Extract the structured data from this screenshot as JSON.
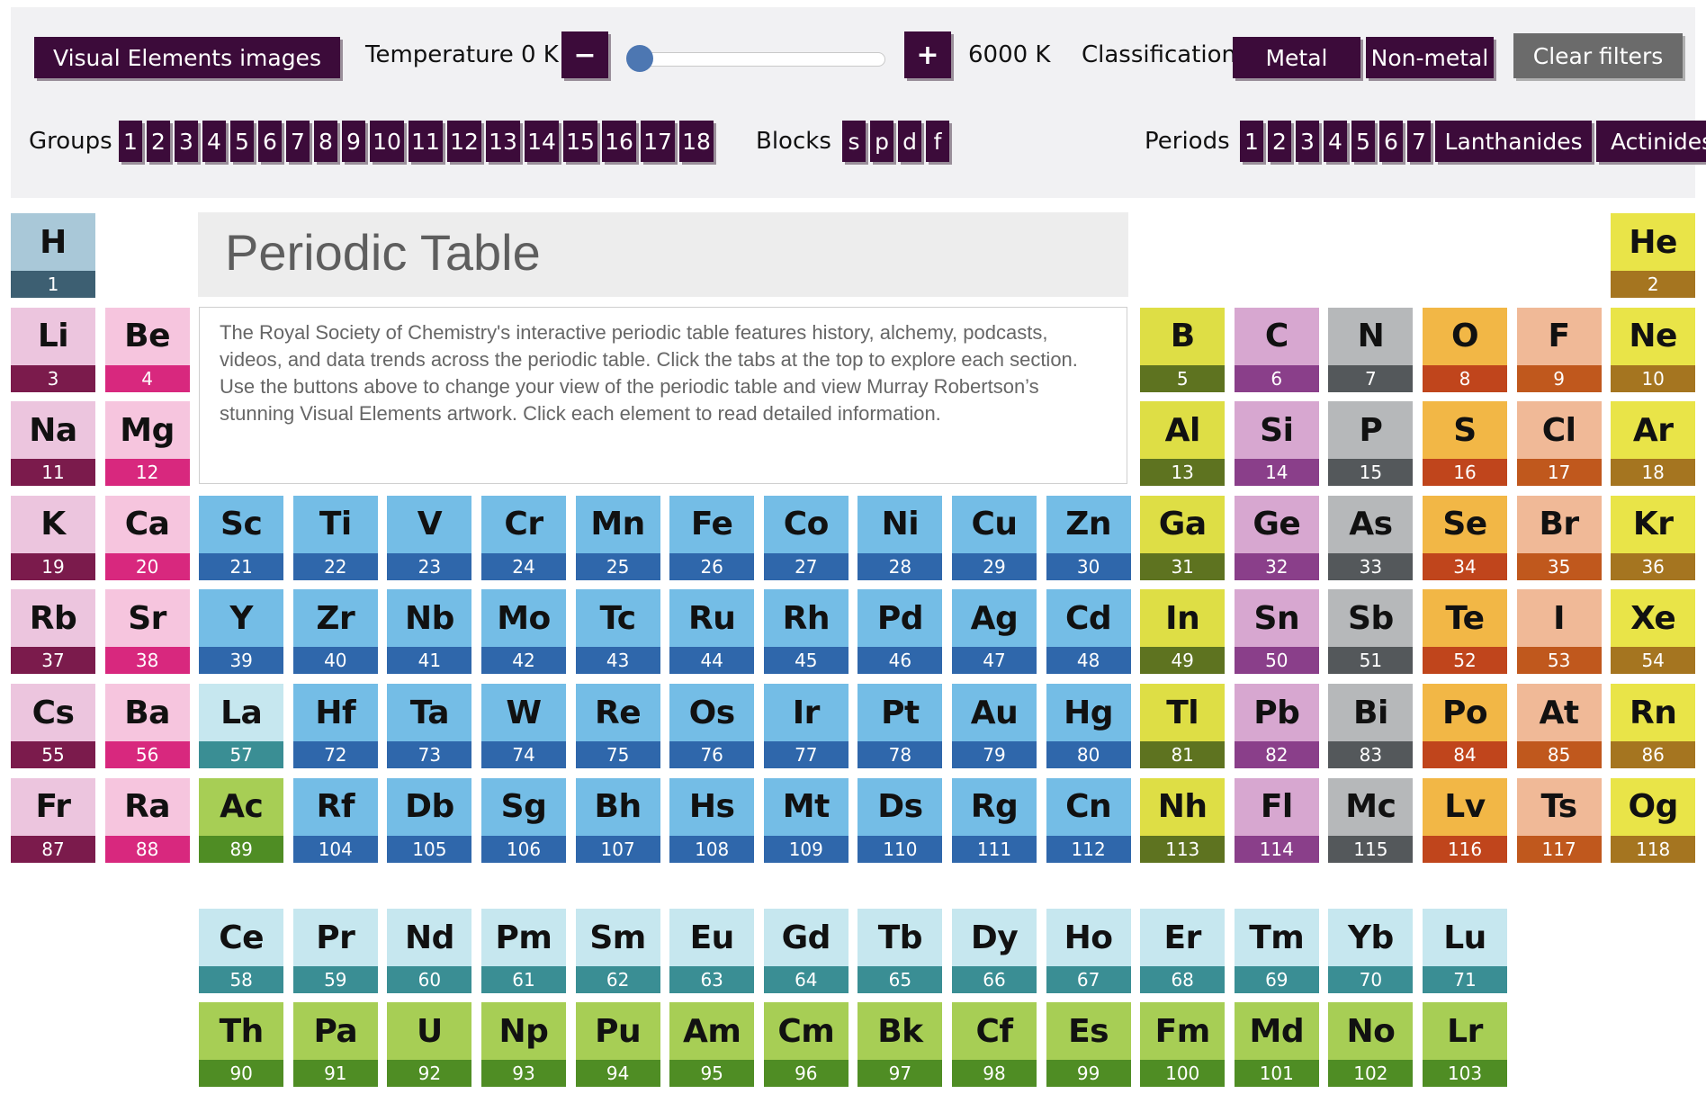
{
  "controls": {
    "visual_elements_label": "Visual Elements images",
    "temperature_label": "Temperature 0 K",
    "minus_symbol": "−",
    "plus_symbol": "+",
    "temperature_value": 0,
    "temperature_max_label": "6000 K",
    "classification_label": "Classification",
    "metal_label": "Metal",
    "nonmetal_label": "Non-metal",
    "clear_label": "Clear filters",
    "groups_label": "Groups",
    "groups": [
      "1",
      "2",
      "3",
      "4",
      "5",
      "6",
      "7",
      "8",
      "9",
      "10",
      "11",
      "12",
      "13",
      "14",
      "15",
      "16",
      "17",
      "18"
    ],
    "blocks_label": "Blocks",
    "blocks": [
      "s",
      "p",
      "d",
      "f"
    ],
    "periods_label": "Periods",
    "periods": [
      "1",
      "2",
      "3",
      "4",
      "5",
      "6",
      "7",
      "Lanthanides",
      "Actinides"
    ]
  },
  "title": "Periodic Table",
  "intro": "The Royal Society of Chemistry's interactive periodic table features history, alchemy, podcasts, videos, and data trends across the periodic table. Click the tabs at the top to explore each section. Use the buttons above to change your view of the periodic table and view Murray Robertson’s stunning Visual Elements artwork. Click each element to read detailed information.",
  "categories": {
    "hydrogen": {
      "top": "#a9c8d8",
      "bottom": "#3d5f72"
    },
    "alkali": {
      "top": "#ecc5de",
      "bottom": "#7b1b4c"
    },
    "alkaline": {
      "top": "#f6c5de",
      "bottom": "#d8287e"
    },
    "transition": {
      "top": "#74bde6",
      "bottom": "#2f67ab"
    },
    "lanthanide": {
      "top": "#c6e7ef",
      "bottom": "#3a8e94"
    },
    "actinide": {
      "top": "#a7ce55",
      "bottom": "#4f8d24"
    },
    "poor": {
      "top": "#dede45",
      "bottom": "#5e7320"
    },
    "metalloid": {
      "top": "#d7a7d0",
      "bottom": "#8a3f8a"
    },
    "nonmetal": {
      "top": "#b6b8ba",
      "bottom": "#54585b"
    },
    "chalcogen": {
      "top": "#f2b746",
      "bottom": "#c0451c"
    },
    "halogen": {
      "top": "#f0b997",
      "bottom": "#c0581d"
    },
    "noble": {
      "top": "#e9e448",
      "bottom": "#a57520"
    }
  },
  "elements": [
    {
      "symbol": "H",
      "number": 1,
      "row": 1,
      "col": 1,
      "cat": "hydrogen"
    },
    {
      "symbol": "He",
      "number": 2,
      "row": 1,
      "col": 18,
      "cat": "noble"
    },
    {
      "symbol": "Li",
      "number": 3,
      "row": 2,
      "col": 1,
      "cat": "alkali"
    },
    {
      "symbol": "Be",
      "number": 4,
      "row": 2,
      "col": 2,
      "cat": "alkaline"
    },
    {
      "symbol": "B",
      "number": 5,
      "row": 2,
      "col": 13,
      "cat": "poor"
    },
    {
      "symbol": "C",
      "number": 6,
      "row": 2,
      "col": 14,
      "cat": "metalloid"
    },
    {
      "symbol": "N",
      "number": 7,
      "row": 2,
      "col": 15,
      "cat": "nonmetal"
    },
    {
      "symbol": "O",
      "number": 8,
      "row": 2,
      "col": 16,
      "cat": "chalcogen"
    },
    {
      "symbol": "F",
      "number": 9,
      "row": 2,
      "col": 17,
      "cat": "halogen"
    },
    {
      "symbol": "Ne",
      "number": 10,
      "row": 2,
      "col": 18,
      "cat": "noble"
    },
    {
      "symbol": "Na",
      "number": 11,
      "row": 3,
      "col": 1,
      "cat": "alkali"
    },
    {
      "symbol": "Mg",
      "number": 12,
      "row": 3,
      "col": 2,
      "cat": "alkaline"
    },
    {
      "symbol": "Al",
      "number": 13,
      "row": 3,
      "col": 13,
      "cat": "poor"
    },
    {
      "symbol": "Si",
      "number": 14,
      "row": 3,
      "col": 14,
      "cat": "metalloid"
    },
    {
      "symbol": "P",
      "number": 15,
      "row": 3,
      "col": 15,
      "cat": "nonmetal"
    },
    {
      "symbol": "S",
      "number": 16,
      "row": 3,
      "col": 16,
      "cat": "chalcogen"
    },
    {
      "symbol": "Cl",
      "number": 17,
      "row": 3,
      "col": 17,
      "cat": "halogen"
    },
    {
      "symbol": "Ar",
      "number": 18,
      "row": 3,
      "col": 18,
      "cat": "noble"
    },
    {
      "symbol": "K",
      "number": 19,
      "row": 4,
      "col": 1,
      "cat": "alkali"
    },
    {
      "symbol": "Ca",
      "number": 20,
      "row": 4,
      "col": 2,
      "cat": "alkaline"
    },
    {
      "symbol": "Sc",
      "number": 21,
      "row": 4,
      "col": 3,
      "cat": "transition"
    },
    {
      "symbol": "Ti",
      "number": 22,
      "row": 4,
      "col": 4,
      "cat": "transition"
    },
    {
      "symbol": "V",
      "number": 23,
      "row": 4,
      "col": 5,
      "cat": "transition"
    },
    {
      "symbol": "Cr",
      "number": 24,
      "row": 4,
      "col": 6,
      "cat": "transition"
    },
    {
      "symbol": "Mn",
      "number": 25,
      "row": 4,
      "col": 7,
      "cat": "transition"
    },
    {
      "symbol": "Fe",
      "number": 26,
      "row": 4,
      "col": 8,
      "cat": "transition"
    },
    {
      "symbol": "Co",
      "number": 27,
      "row": 4,
      "col": 9,
      "cat": "transition"
    },
    {
      "symbol": "Ni",
      "number": 28,
      "row": 4,
      "col": 10,
      "cat": "transition"
    },
    {
      "symbol": "Cu",
      "number": 29,
      "row": 4,
      "col": 11,
      "cat": "transition"
    },
    {
      "symbol": "Zn",
      "number": 30,
      "row": 4,
      "col": 12,
      "cat": "transition"
    },
    {
      "symbol": "Ga",
      "number": 31,
      "row": 4,
      "col": 13,
      "cat": "poor"
    },
    {
      "symbol": "Ge",
      "number": 32,
      "row": 4,
      "col": 14,
      "cat": "metalloid"
    },
    {
      "symbol": "As",
      "number": 33,
      "row": 4,
      "col": 15,
      "cat": "nonmetal"
    },
    {
      "symbol": "Se",
      "number": 34,
      "row": 4,
      "col": 16,
      "cat": "chalcogen"
    },
    {
      "symbol": "Br",
      "number": 35,
      "row": 4,
      "col": 17,
      "cat": "halogen"
    },
    {
      "symbol": "Kr",
      "number": 36,
      "row": 4,
      "col": 18,
      "cat": "noble"
    },
    {
      "symbol": "Rb",
      "number": 37,
      "row": 5,
      "col": 1,
      "cat": "alkali"
    },
    {
      "symbol": "Sr",
      "number": 38,
      "row": 5,
      "col": 2,
      "cat": "alkaline"
    },
    {
      "symbol": "Y",
      "number": 39,
      "row": 5,
      "col": 3,
      "cat": "transition"
    },
    {
      "symbol": "Zr",
      "number": 40,
      "row": 5,
      "col": 4,
      "cat": "transition"
    },
    {
      "symbol": "Nb",
      "number": 41,
      "row": 5,
      "col": 5,
      "cat": "transition"
    },
    {
      "symbol": "Mo",
      "number": 42,
      "row": 5,
      "col": 6,
      "cat": "transition"
    },
    {
      "symbol": "Tc",
      "number": 43,
      "row": 5,
      "col": 7,
      "cat": "transition"
    },
    {
      "symbol": "Ru",
      "number": 44,
      "row": 5,
      "col": 8,
      "cat": "transition"
    },
    {
      "symbol": "Rh",
      "number": 45,
      "row": 5,
      "col": 9,
      "cat": "transition"
    },
    {
      "symbol": "Pd",
      "number": 46,
      "row": 5,
      "col": 10,
      "cat": "transition"
    },
    {
      "symbol": "Ag",
      "number": 47,
      "row": 5,
      "col": 11,
      "cat": "transition"
    },
    {
      "symbol": "Cd",
      "number": 48,
      "row": 5,
      "col": 12,
      "cat": "transition"
    },
    {
      "symbol": "In",
      "number": 49,
      "row": 5,
      "col": 13,
      "cat": "poor"
    },
    {
      "symbol": "Sn",
      "number": 50,
      "row": 5,
      "col": 14,
      "cat": "metalloid"
    },
    {
      "symbol": "Sb",
      "number": 51,
      "row": 5,
      "col": 15,
      "cat": "nonmetal"
    },
    {
      "symbol": "Te",
      "number": 52,
      "row": 5,
      "col": 16,
      "cat": "chalcogen"
    },
    {
      "symbol": "I",
      "number": 53,
      "row": 5,
      "col": 17,
      "cat": "halogen"
    },
    {
      "symbol": "Xe",
      "number": 54,
      "row": 5,
      "col": 18,
      "cat": "noble"
    },
    {
      "symbol": "Cs",
      "number": 55,
      "row": 6,
      "col": 1,
      "cat": "alkali"
    },
    {
      "symbol": "Ba",
      "number": 56,
      "row": 6,
      "col": 2,
      "cat": "alkaline"
    },
    {
      "symbol": "La",
      "number": 57,
      "row": 6,
      "col": 3,
      "cat": "lanthanide"
    },
    {
      "symbol": "Hf",
      "number": 72,
      "row": 6,
      "col": 4,
      "cat": "transition"
    },
    {
      "symbol": "Ta",
      "number": 73,
      "row": 6,
      "col": 5,
      "cat": "transition"
    },
    {
      "symbol": "W",
      "number": 74,
      "row": 6,
      "col": 6,
      "cat": "transition"
    },
    {
      "symbol": "Re",
      "number": 75,
      "row": 6,
      "col": 7,
      "cat": "transition"
    },
    {
      "symbol": "Os",
      "number": 76,
      "row": 6,
      "col": 8,
      "cat": "transition"
    },
    {
      "symbol": "Ir",
      "number": 77,
      "row": 6,
      "col": 9,
      "cat": "transition"
    },
    {
      "symbol": "Pt",
      "number": 78,
      "row": 6,
      "col": 10,
      "cat": "transition"
    },
    {
      "symbol": "Au",
      "number": 79,
      "row": 6,
      "col": 11,
      "cat": "transition"
    },
    {
      "symbol": "Hg",
      "number": 80,
      "row": 6,
      "col": 12,
      "cat": "transition"
    },
    {
      "symbol": "Tl",
      "number": 81,
      "row": 6,
      "col": 13,
      "cat": "poor"
    },
    {
      "symbol": "Pb",
      "number": 82,
      "row": 6,
      "col": 14,
      "cat": "metalloid"
    },
    {
      "symbol": "Bi",
      "number": 83,
      "row": 6,
      "col": 15,
      "cat": "nonmetal"
    },
    {
      "symbol": "Po",
      "number": 84,
      "row": 6,
      "col": 16,
      "cat": "chalcogen"
    },
    {
      "symbol": "At",
      "number": 85,
      "row": 6,
      "col": 17,
      "cat": "halogen"
    },
    {
      "symbol": "Rn",
      "number": 86,
      "row": 6,
      "col": 18,
      "cat": "noble"
    },
    {
      "symbol": "Fr",
      "number": 87,
      "row": 7,
      "col": 1,
      "cat": "alkali"
    },
    {
      "symbol": "Ra",
      "number": 88,
      "row": 7,
      "col": 2,
      "cat": "alkaline"
    },
    {
      "symbol": "Ac",
      "number": 89,
      "row": 7,
      "col": 3,
      "cat": "actinide"
    },
    {
      "symbol": "Rf",
      "number": 104,
      "row": 7,
      "col": 4,
      "cat": "transition"
    },
    {
      "symbol": "Db",
      "number": 105,
      "row": 7,
      "col": 5,
      "cat": "transition"
    },
    {
      "symbol": "Sg",
      "number": 106,
      "row": 7,
      "col": 6,
      "cat": "transition"
    },
    {
      "symbol": "Bh",
      "number": 107,
      "row": 7,
      "col": 7,
      "cat": "transition"
    },
    {
      "symbol": "Hs",
      "number": 108,
      "row": 7,
      "col": 8,
      "cat": "transition"
    },
    {
      "symbol": "Mt",
      "number": 109,
      "row": 7,
      "col": 9,
      "cat": "transition"
    },
    {
      "symbol": "Ds",
      "number": 110,
      "row": 7,
      "col": 10,
      "cat": "transition"
    },
    {
      "symbol": "Rg",
      "number": 111,
      "row": 7,
      "col": 11,
      "cat": "transition"
    },
    {
      "symbol": "Cn",
      "number": 112,
      "row": 7,
      "col": 12,
      "cat": "transition"
    },
    {
      "symbol": "Nh",
      "number": 113,
      "row": 7,
      "col": 13,
      "cat": "poor"
    },
    {
      "symbol": "Fl",
      "number": 114,
      "row": 7,
      "col": 14,
      "cat": "metalloid"
    },
    {
      "symbol": "Mc",
      "number": 115,
      "row": 7,
      "col": 15,
      "cat": "nonmetal"
    },
    {
      "symbol": "Lv",
      "number": 116,
      "row": 7,
      "col": 16,
      "cat": "chalcogen"
    },
    {
      "symbol": "Ts",
      "number": 117,
      "row": 7,
      "col": 17,
      "cat": "halogen"
    },
    {
      "symbol": "Og",
      "number": 118,
      "row": 7,
      "col": 18,
      "cat": "noble"
    },
    {
      "symbol": "Ce",
      "number": 58,
      "row": 8,
      "col": 3,
      "cat": "lanthanide"
    },
    {
      "symbol": "Pr",
      "number": 59,
      "row": 8,
      "col": 4,
      "cat": "lanthanide"
    },
    {
      "symbol": "Nd",
      "number": 60,
      "row": 8,
      "col": 5,
      "cat": "lanthanide"
    },
    {
      "symbol": "Pm",
      "number": 61,
      "row": 8,
      "col": 6,
      "cat": "lanthanide"
    },
    {
      "symbol": "Sm",
      "number": 62,
      "row": 8,
      "col": 7,
      "cat": "lanthanide"
    },
    {
      "symbol": "Eu",
      "number": 63,
      "row": 8,
      "col": 8,
      "cat": "lanthanide"
    },
    {
      "symbol": "Gd",
      "number": 64,
      "row": 8,
      "col": 9,
      "cat": "lanthanide"
    },
    {
      "symbol": "Tb",
      "number": 65,
      "row": 8,
      "col": 10,
      "cat": "lanthanide"
    },
    {
      "symbol": "Dy",
      "number": 66,
      "row": 8,
      "col": 11,
      "cat": "lanthanide"
    },
    {
      "symbol": "Ho",
      "number": 67,
      "row": 8,
      "col": 12,
      "cat": "lanthanide"
    },
    {
      "symbol": "Er",
      "number": 68,
      "row": 8,
      "col": 13,
      "cat": "lanthanide"
    },
    {
      "symbol": "Tm",
      "number": 69,
      "row": 8,
      "col": 14,
      "cat": "lanthanide"
    },
    {
      "symbol": "Yb",
      "number": 70,
      "row": 8,
      "col": 15,
      "cat": "lanthanide"
    },
    {
      "symbol": "Lu",
      "number": 71,
      "row": 8,
      "col": 16,
      "cat": "lanthanide"
    },
    {
      "symbol": "Th",
      "number": 90,
      "row": 9,
      "col": 3,
      "cat": "actinide"
    },
    {
      "symbol": "Pa",
      "number": 91,
      "row": 9,
      "col": 4,
      "cat": "actinide"
    },
    {
      "symbol": "U",
      "number": 92,
      "row": 9,
      "col": 5,
      "cat": "actinide"
    },
    {
      "symbol": "Np",
      "number": 93,
      "row": 9,
      "col": 6,
      "cat": "actinide"
    },
    {
      "symbol": "Pu",
      "number": 94,
      "row": 9,
      "col": 7,
      "cat": "actinide"
    },
    {
      "symbol": "Am",
      "number": 95,
      "row": 9,
      "col": 8,
      "cat": "actinide"
    },
    {
      "symbol": "Cm",
      "number": 96,
      "row": 9,
      "col": 9,
      "cat": "actinide"
    },
    {
      "symbol": "Bk",
      "number": 97,
      "row": 9,
      "col": 10,
      "cat": "actinide"
    },
    {
      "symbol": "Cf",
      "number": 98,
      "row": 9,
      "col": 11,
      "cat": "actinide"
    },
    {
      "symbol": "Es",
      "number": 99,
      "row": 9,
      "col": 12,
      "cat": "actinide"
    },
    {
      "symbol": "Fm",
      "number": 100,
      "row": 9,
      "col": 13,
      "cat": "actinide"
    },
    {
      "symbol": "Md",
      "number": 101,
      "row": 9,
      "col": 14,
      "cat": "actinide"
    },
    {
      "symbol": "No",
      "number": 102,
      "row": 9,
      "col": 15,
      "cat": "actinide"
    },
    {
      "symbol": "Lr",
      "number": 103,
      "row": 9,
      "col": 16,
      "cat": "actinide"
    }
  ]
}
